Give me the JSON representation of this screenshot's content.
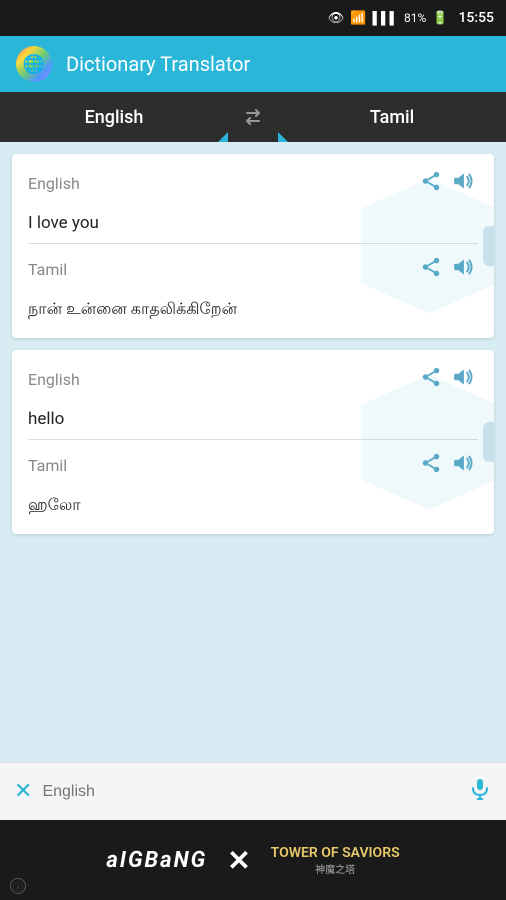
{
  "statusBar": {
    "time": "15:55",
    "battery": "81%"
  },
  "appBar": {
    "title": "Dictionary Translator",
    "iconEmoji": "🌐"
  },
  "langBar": {
    "sourceLang": "English",
    "targetLang": "Tamil",
    "swapSymbol": "⟳"
  },
  "cards": [
    {
      "sourceLang": "English",
      "sourceText": "I love you",
      "targetLang": "Tamil",
      "targetText": "நான் உன்னை காதலிக்கிறேன்"
    },
    {
      "sourceLang": "English",
      "sourceText": "hello",
      "targetLang": "Tamil",
      "targetText": "ஹலோ"
    }
  ],
  "bottomInput": {
    "placeholder": "English",
    "closeLabel": "✕",
    "micLabel": "🎤"
  },
  "adBanner": {
    "brand": "aIGBaNG",
    "separator": "✕",
    "gameName": "TOWER OF SAVIORS",
    "gameSubtitle": "神魔之塔",
    "infoLabel": "ⓘ"
  },
  "icons": {
    "share": "share-icon",
    "volume": "volume-icon",
    "swap": "swap-icon",
    "close": "close-icon",
    "mic": "mic-icon"
  }
}
